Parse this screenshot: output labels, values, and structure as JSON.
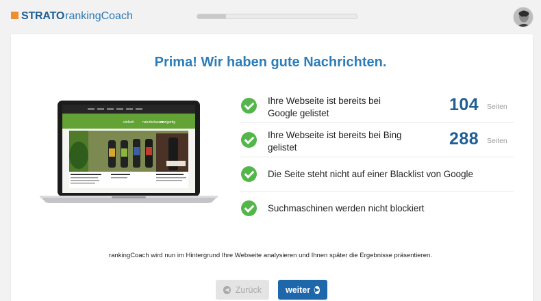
{
  "header": {
    "logo_brand": "STRATO",
    "logo_product": "rankingCoach",
    "progress": 0.18
  },
  "main": {
    "headline": "Prima! Wir haben gute Nachrichten.",
    "screen_tagline": [
      "einfach",
      "naturbelassen",
      "einzigartig"
    ],
    "results": [
      {
        "text": "Ihre Webseite ist bereits bei Google gelistet",
        "count": "104",
        "unit": "Seiten"
      },
      {
        "text": "Ihre Webseite ist bereits bei Bing gelistet",
        "count": "288",
        "unit": "Seiten"
      },
      {
        "text": "Die Seite steht nicht auf einer Blacklist von Google"
      },
      {
        "text": "Suchmaschinen werden nicht blockiert"
      }
    ],
    "info_text": "rankingCoach wird nun im Hintergrund Ihre Webseite analysieren und Ihnen später die Ergebnisse präsentieren."
  },
  "buttons": {
    "back_label": "Zurück",
    "next_label": "weiter"
  },
  "colors": {
    "accent": "#2c7db9",
    "brand_dark": "#1f5f95",
    "success": "#53b64a",
    "button_primary": "#1e67aa"
  }
}
